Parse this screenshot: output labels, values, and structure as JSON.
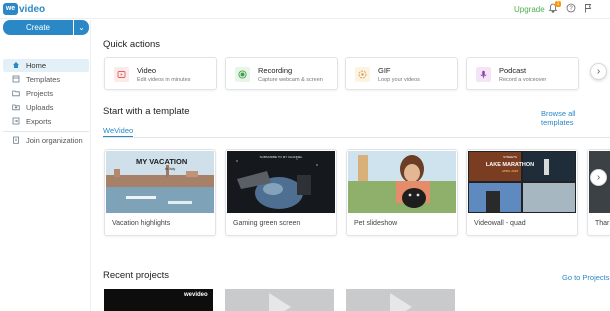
{
  "header": {
    "logo_badge": "we",
    "logo_text": "video",
    "upgrade_label": "Upgrade",
    "notification_count": "1"
  },
  "sidebar": {
    "create_label": "Create",
    "items": [
      {
        "label": "Home",
        "icon": "home-icon"
      },
      {
        "label": "Templates",
        "icon": "templates-icon"
      },
      {
        "label": "Projects",
        "icon": "folder-icon"
      },
      {
        "label": "Uploads",
        "icon": "upload-icon"
      },
      {
        "label": "Exports",
        "icon": "export-icon"
      },
      {
        "label": "Join organization",
        "icon": "organization-icon"
      }
    ]
  },
  "quick_actions": {
    "heading": "Quick actions",
    "cards": [
      {
        "title": "Video",
        "subtitle": "Edit videos in minutes",
        "icon": "video-icon",
        "color": "#fdeaea",
        "icon_color": "#e0625a"
      },
      {
        "title": "Recording",
        "subtitle": "Capture webcam & screen",
        "icon": "record-icon",
        "color": "#e8f5e9",
        "icon_color": "#43a047"
      },
      {
        "title": "GIF",
        "subtitle": "Loop your videos",
        "icon": "gif-icon",
        "color": "#fdf3e0",
        "icon_color": "#c9a04a"
      },
      {
        "title": "Podcast",
        "subtitle": "Record a voiceover",
        "icon": "microphone-icon",
        "color": "#f3e5f5",
        "icon_color": "#8e44ad"
      }
    ]
  },
  "templates": {
    "heading": "Start with a template",
    "browse_label": "Browse all templates",
    "tab_label": "WeVideo",
    "cards": [
      {
        "label": "Vacation highlights",
        "thumb_title": "MY VACATION",
        "thumb_sub": "to Italy"
      },
      {
        "label": "Gaming green screen",
        "thumb_title": "SUBSCRIBE TO MY CHANNEL"
      },
      {
        "label": "Pet slideshow"
      },
      {
        "label": "Videowall - quad",
        "thumb_title": "LAKE MARATHON",
        "thumb_top": "STREETS",
        "thumb_sub": "APRIL 2018"
      },
      {
        "label": "Thar"
      }
    ]
  },
  "recent": {
    "heading": "Recent projects",
    "go_label": "Go to Projects",
    "watermark": "wevideo"
  }
}
